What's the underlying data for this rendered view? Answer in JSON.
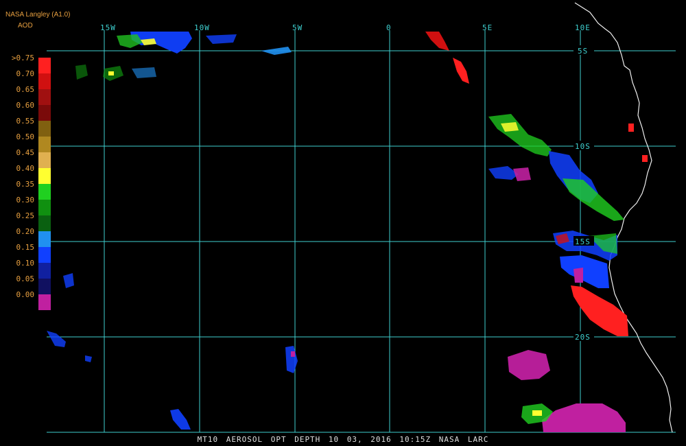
{
  "header": {
    "source": "NASA Langley (A1.0)",
    "product": "AOD"
  },
  "footer": {
    "caption": "MT10  AEROSOL OPT DEPTH   10 03, 2016 10:15Z   NASA LARC"
  },
  "axes": {
    "lon_labels": [
      "15W",
      "10W",
      "5W",
      "0",
      "5E",
      "10E"
    ],
    "lat_labels": [
      "5S",
      "10S",
      "15S",
      "20S"
    ],
    "grid_color": "#3fd0d0"
  },
  "legend": {
    "labels": [
      ">0.75",
      "0.70",
      "0.65",
      "0.60",
      "0.55",
      "0.50",
      "0.45",
      "0.40",
      "0.35",
      "0.30",
      "0.25",
      "0.20",
      "0.15",
      "0.10",
      "0.05",
      "0.00"
    ],
    "colors": [
      "#ff2020",
      "#d01010",
      "#a01010",
      "#7a0a0a",
      "#806010",
      "#b08820",
      "#e0b050",
      "#ffff30",
      "#20d020",
      "#109010",
      "#0a6010",
      "#2090f0",
      "#1040ff",
      "#1020a0",
      "#101060",
      "#c020a0"
    ]
  }
}
